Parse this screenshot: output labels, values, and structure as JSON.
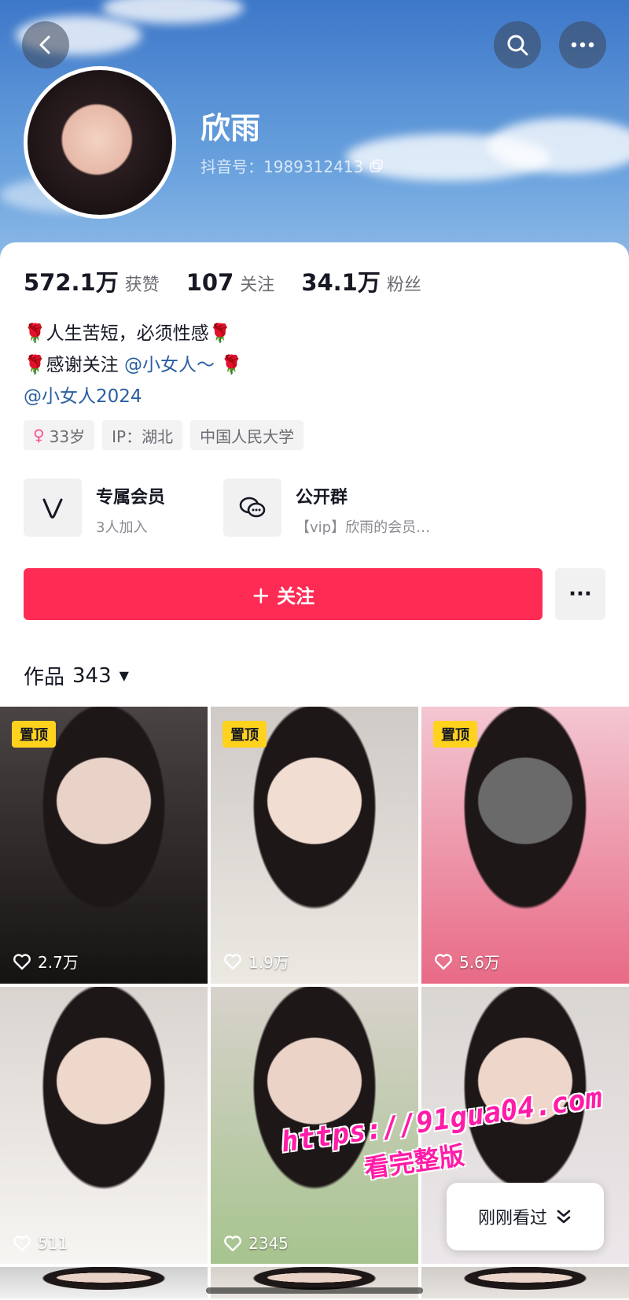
{
  "header": {
    "nickname": "欣雨",
    "douyin_id": "抖音号：1989312413"
  },
  "stats": [
    {
      "value": "572.1万",
      "label": "获赞"
    },
    {
      "value": "107",
      "label": "关注"
    },
    {
      "value": "34.1万",
      "label": "粉丝"
    }
  ],
  "bio": {
    "line1": "人生苦短，必须性感",
    "line2_prefix": "感谢关注 ",
    "line2_mention": "@小女人～",
    "line3_mention": "@小女人2024"
  },
  "tags": [
    {
      "text": "33岁"
    },
    {
      "text": "IP：湖北"
    },
    {
      "text": "中国人民大学"
    }
  ],
  "features": [
    {
      "title": "专属会员",
      "sub": "3人加入"
    },
    {
      "title": "公开群",
      "sub": "【vip】欣雨的会员…"
    }
  ],
  "actions": {
    "follow_label": "＋ 关注",
    "more_label": "···"
  },
  "works": {
    "label": "作品",
    "count": "343"
  },
  "tiles": [
    {
      "pinned": true,
      "pin_label": "置顶",
      "likes": "2.7万",
      "palette": [
        "#4a4444",
        "#e9d3c8",
        "#151212"
      ]
    },
    {
      "pinned": true,
      "pin_label": "置顶",
      "likes": "1.9万",
      "palette": [
        "#cfcac6",
        "#f2ddd2",
        "#ece8e2"
      ]
    },
    {
      "pinned": true,
      "pin_label": "置顶",
      "likes": "5.6万",
      "palette": [
        "#f3c7d2",
        "#6a6a6a",
        "#e86a86"
      ]
    },
    {
      "pinned": false,
      "likes": "511",
      "palette": [
        "#d9d4cf",
        "#eed7cb",
        "#f7f5f2"
      ]
    },
    {
      "pinned": false,
      "likes": "2345",
      "palette": [
        "#d8d2cc",
        "#ebd4c7",
        "#a6c48e"
      ]
    },
    {
      "pinned": false,
      "likes": "",
      "palette": [
        "#d9d6d2",
        "#eed6cb",
        "#ece7ea"
      ]
    }
  ],
  "overlay": {
    "just_seen_label": "刚刚看过",
    "watermark_url": "https://91gua04.com",
    "watermark_cta": "看完整版"
  },
  "colors": {
    "follow_button": "#fe2c55",
    "pin_badge": "#ffd21e",
    "mention": "#2a5fa0",
    "watermark": "#ff1ca8"
  }
}
